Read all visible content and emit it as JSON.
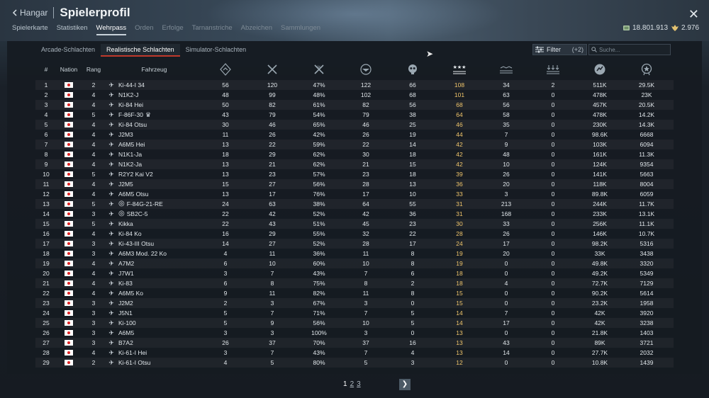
{
  "header": {
    "back_label": "Hangar",
    "title": "Spielerprofil",
    "close_icon": "close-icon"
  },
  "currency": {
    "silver": "18.801.913",
    "gold": "2.976"
  },
  "nav_tabs": [
    "Spielerkarte",
    "Statistiken",
    "Wehrpass",
    "Orden",
    "Erfolge",
    "Tarnanstriche",
    "Abzeichen",
    "Sammlungen"
  ],
  "active_nav": "Wehrpass",
  "mode_tabs": [
    "Arcade-Schlachten",
    "Realistische Schlachten",
    "Simulator-Schlachten"
  ],
  "active_mode": "Realistische Schlachten",
  "filter": {
    "label": "Filter",
    "count": "(+2)"
  },
  "search": {
    "placeholder": "Suche..."
  },
  "columns": {
    "num": "#",
    "nation": "Nation",
    "rank": "Rang",
    "vehicle": "Fahrzeug",
    "stat_icons": [
      "battles-icon",
      "victories-icon",
      "win-rate-icon",
      "respawns-icon",
      "deaths-icon",
      "air-kills-icon",
      "ground-kills-icon",
      "naval-kills-icon",
      "score-icon",
      "experience-icon"
    ]
  },
  "rows": [
    [
      "1",
      "2",
      "Ki-44-I 34",
      "",
      "56",
      "120",
      "47%",
      "122",
      "66",
      "108",
      "34",
      "2",
      "511K",
      "29.5K"
    ],
    [
      "2",
      "4",
      "N1K2-J",
      "",
      "48",
      "99",
      "48%",
      "102",
      "68",
      "101",
      "63",
      "0",
      "478K",
      "23K"
    ],
    [
      "3",
      "4",
      "Ki-84 Hei",
      "",
      "50",
      "82",
      "61%",
      "82",
      "56",
      "68",
      "56",
      "0",
      "457K",
      "20.5K"
    ],
    [
      "4",
      "5",
      "F-86F-30",
      "squadron",
      "43",
      "79",
      "54%",
      "79",
      "38",
      "64",
      "58",
      "0",
      "478K",
      "14.2K"
    ],
    [
      "5",
      "4",
      "Ki-84 Otsu",
      "",
      "30",
      "46",
      "65%",
      "46",
      "25",
      "46",
      "35",
      "0",
      "230K",
      "14.3K"
    ],
    [
      "6",
      "4",
      "J2M3",
      "",
      "11",
      "26",
      "42%",
      "26",
      "19",
      "44",
      "7",
      "0",
      "98.6K",
      "6668"
    ],
    [
      "7",
      "4",
      "A6M5 Hei",
      "",
      "13",
      "22",
      "59%",
      "22",
      "14",
      "42",
      "9",
      "0",
      "103K",
      "6094"
    ],
    [
      "8",
      "4",
      "N1K1-Ja",
      "",
      "18",
      "29",
      "62%",
      "30",
      "18",
      "42",
      "48",
      "0",
      "161K",
      "11.3K"
    ],
    [
      "9",
      "4",
      "N1K2-Ja",
      "",
      "13",
      "21",
      "62%",
      "21",
      "15",
      "42",
      "10",
      "0",
      "124K",
      "9354"
    ],
    [
      "10",
      "5",
      "R2Y2 Kai V2",
      "",
      "13",
      "23",
      "57%",
      "23",
      "18",
      "39",
      "26",
      "0",
      "141K",
      "5663"
    ],
    [
      "11",
      "4",
      "J2M5",
      "",
      "15",
      "27",
      "56%",
      "28",
      "13",
      "36",
      "20",
      "0",
      "118K",
      "8004"
    ],
    [
      "12",
      "4",
      "A6M5 Otsu",
      "",
      "13",
      "17",
      "76%",
      "17",
      "10",
      "33",
      "3",
      "0",
      "89.8K",
      "6059"
    ],
    [
      "13",
      "5",
      "F-84G-21-RE",
      "target",
      "24",
      "63",
      "38%",
      "64",
      "55",
      "31",
      "213",
      "0",
      "244K",
      "11.7K"
    ],
    [
      "14",
      "3",
      "SB2C-5",
      "target",
      "22",
      "42",
      "52%",
      "42",
      "36",
      "31",
      "168",
      "0",
      "233K",
      "13.1K"
    ],
    [
      "15",
      "5",
      "Kikka",
      "",
      "22",
      "43",
      "51%",
      "45",
      "23",
      "30",
      "33",
      "0",
      "256K",
      "11.1K"
    ],
    [
      "16",
      "4",
      "Ki-84 Ko",
      "",
      "16",
      "29",
      "55%",
      "32",
      "22",
      "28",
      "26",
      "0",
      "146K",
      "10.7K"
    ],
    [
      "17",
      "3",
      "Ki-43-III Otsu",
      "",
      "14",
      "27",
      "52%",
      "28",
      "17",
      "24",
      "17",
      "0",
      "98.2K",
      "5316"
    ],
    [
      "18",
      "3",
      "A6M3 Mod. 22 Ko",
      "",
      "4",
      "11",
      "36%",
      "11",
      "8",
      "19",
      "20",
      "0",
      "33K",
      "3438"
    ],
    [
      "19",
      "4",
      "A7M2",
      "",
      "6",
      "10",
      "60%",
      "10",
      "8",
      "19",
      "0",
      "0",
      "49.8K",
      "3320"
    ],
    [
      "20",
      "4",
      "J7W1",
      "",
      "3",
      "7",
      "43%",
      "7",
      "6",
      "18",
      "0",
      "0",
      "49.2K",
      "5349"
    ],
    [
      "21",
      "4",
      "Ki-83",
      "",
      "6",
      "8",
      "75%",
      "8",
      "2",
      "18",
      "4",
      "0",
      "72.7K",
      "7129"
    ],
    [
      "22",
      "4",
      "A6M5 Ko",
      "",
      "9",
      "11",
      "82%",
      "11",
      "8",
      "15",
      "0",
      "0",
      "90.2K",
      "5614"
    ],
    [
      "23",
      "3",
      "J2M2",
      "",
      "2",
      "3",
      "67%",
      "3",
      "0",
      "15",
      "0",
      "0",
      "23.2K",
      "1958"
    ],
    [
      "24",
      "3",
      "J5N1",
      "",
      "5",
      "7",
      "71%",
      "7",
      "5",
      "14",
      "7",
      "0",
      "42K",
      "3920"
    ],
    [
      "25",
      "3",
      "Ki-100",
      "",
      "5",
      "9",
      "56%",
      "10",
      "5",
      "14",
      "17",
      "0",
      "42K",
      "3238"
    ],
    [
      "26",
      "3",
      "A6M5",
      "",
      "3",
      "3",
      "100%",
      "3",
      "0",
      "13",
      "0",
      "0",
      "21.8K",
      "1403"
    ],
    [
      "27",
      "3",
      "B7A2",
      "",
      "26",
      "37",
      "70%",
      "37",
      "16",
      "13",
      "43",
      "0",
      "89K",
      "3721"
    ],
    [
      "28",
      "4",
      "Ki-61-I Hei",
      "",
      "3",
      "7",
      "43%",
      "7",
      "4",
      "13",
      "14",
      "0",
      "27.7K",
      "2032"
    ],
    [
      "29",
      "2",
      "Ki-61-I Otsu",
      "",
      "4",
      "5",
      "80%",
      "5",
      "3",
      "12",
      "0",
      "0",
      "10.8K",
      "1439"
    ]
  ],
  "pager": {
    "pages": [
      "1",
      "2",
      "3"
    ],
    "current": "1",
    "next_icon": "chevron-right-icon"
  },
  "colors": {
    "accent": "#c0392b",
    "highlight": "#f0c56a"
  }
}
